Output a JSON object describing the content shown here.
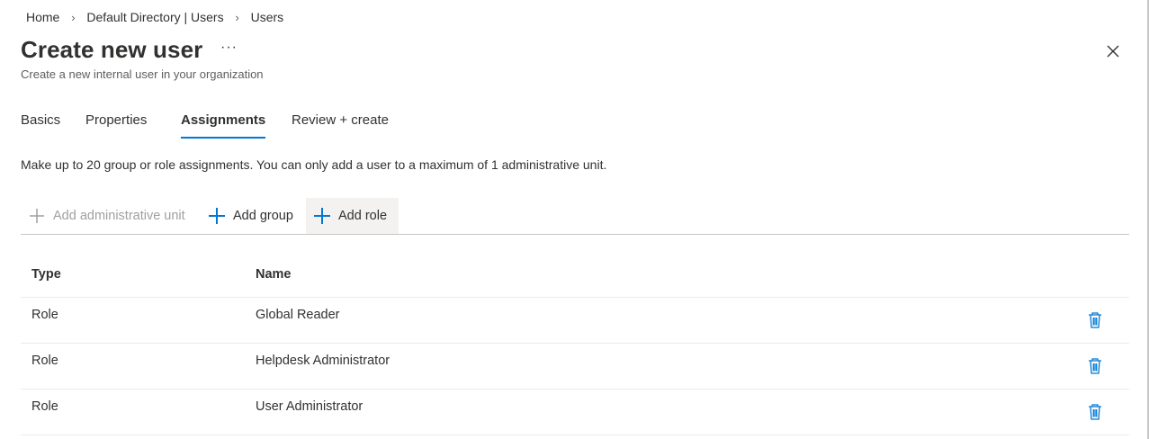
{
  "breadcrumb": {
    "items": [
      "Home",
      "Default Directory | Users",
      "Users"
    ],
    "separator": "›"
  },
  "header": {
    "title": "Create new user",
    "more_label": "···",
    "subtitle": "Create a new internal user in your organization",
    "close_icon": "close-icon"
  },
  "tabs": [
    {
      "label": "Basics",
      "active": false
    },
    {
      "label": "Properties",
      "active": false
    },
    {
      "label": "Assignments",
      "active": true
    },
    {
      "label": "Review + create",
      "active": false
    }
  ],
  "info_text": "Make up to 20 group or role assignments. You can only add a user to a maximum of 1 administrative unit.",
  "commands": [
    {
      "label": "Add administrative unit",
      "icon": "plus-icon",
      "disabled": true
    },
    {
      "label": "Add group",
      "icon": "plus-icon",
      "disabled": false
    },
    {
      "label": "Add role",
      "icon": "plus-icon",
      "disabled": false
    }
  ],
  "table": {
    "columns": [
      "Type",
      "Name"
    ],
    "rows": [
      {
        "type": "Role",
        "name": "Global Reader"
      },
      {
        "type": "Role",
        "name": "Helpdesk Administrator"
      },
      {
        "type": "Role",
        "name": "User Administrator"
      }
    ],
    "row_action_icon": "trash-icon"
  },
  "colors": {
    "accent": "#0078d4",
    "text": "#323130",
    "text_secondary": "#605e5c",
    "disabled": "#a19f9d",
    "divider": "#c8c6c4",
    "hover_bg": "#f3f2f1"
  }
}
